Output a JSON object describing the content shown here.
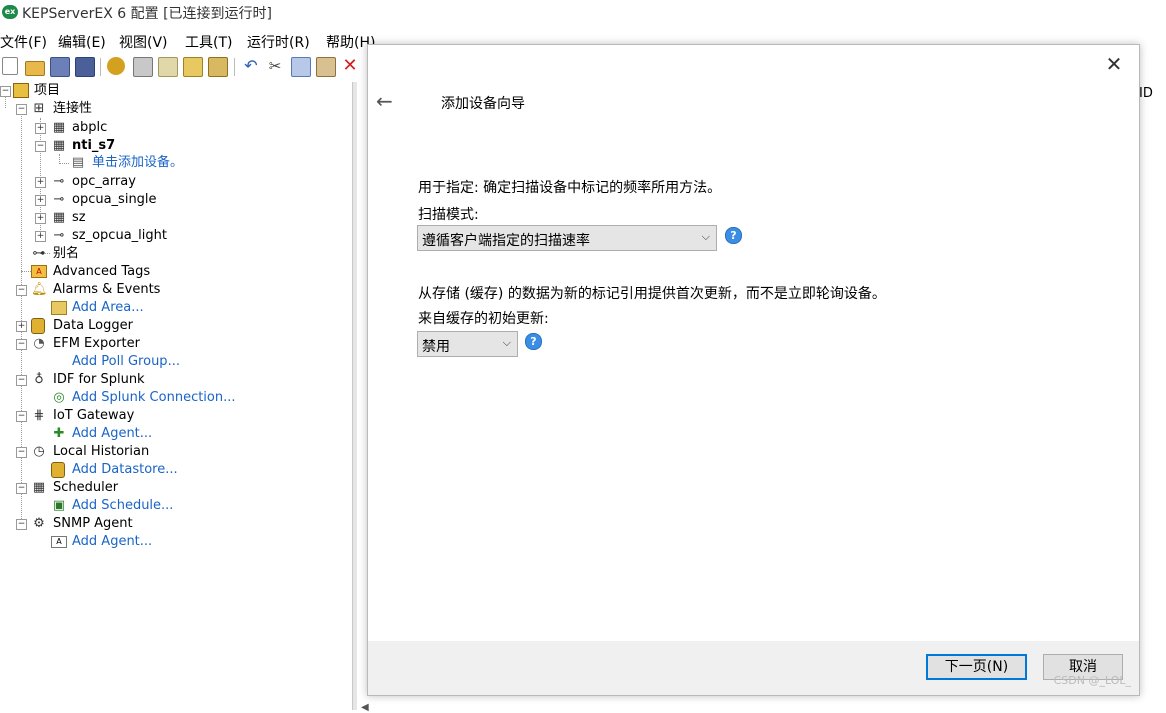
{
  "window": {
    "logo": "ex",
    "title": "KEPServerEX 6 配置 [已连接到运行时]"
  },
  "menu": [
    "文件(F)",
    "编辑(E)",
    "视图(V)",
    "工具(T)",
    "运行时(R)",
    "帮助(H)"
  ],
  "toolbar": {
    "icons": [
      "new-file-icon",
      "open-folder-icon",
      "save-icon",
      "save-as-icon",
      "runtime-gear-icon",
      "new-channel-icon",
      "new-device-icon",
      "new-tag-group-icon",
      "import-icon",
      "undo-icon",
      "cut-icon",
      "copy-icon",
      "paste-icon",
      "delete-icon"
    ]
  },
  "tree": {
    "project": "项目",
    "connectivity": "连接性",
    "abplc": "abplc",
    "nti_s7": "nti_s7",
    "add_device": "单击添加设备。",
    "opc_array": "opc_array",
    "opcua_single": "opcua_single",
    "sz": "sz",
    "sz_opcua_light": "sz_opcua_light",
    "alias": "别名",
    "advanced_tags": "Advanced Tags",
    "alarms_events": "Alarms & Events",
    "add_area": "Add Area...",
    "data_logger": "Data Logger",
    "efm_exporter": "EFM Exporter",
    "add_poll_group": "Add Poll Group...",
    "idf_splunk": "IDF for Splunk",
    "add_splunk": "Add Splunk Connection...",
    "iot_gateway": "IoT Gateway",
    "add_agent_iot": "Add Agent...",
    "local_historian": "Local Historian",
    "add_datastore": "Add Datastore...",
    "scheduler": "Scheduler",
    "add_schedule": "Add Schedule...",
    "snmp_agent": "SNMP Agent",
    "add_agent_snmp": "Add Agent..."
  },
  "rightpane": {
    "col_fragment": "ID"
  },
  "dialog": {
    "title": "添加设备向导",
    "desc1": "用于指定: 确定扫描设备中标记的频率所用方法。",
    "scan_mode_label": "扫描模式:",
    "scan_mode_value": "遵循客户端指定的扫描速率",
    "desc2": "从存储 (缓存) 的数据为新的标记引用提供首次更新，而不是立即轮询设备。",
    "cache_label": "来自缓存的初始更新:",
    "cache_value": "禁用",
    "help_glyph": "?",
    "close_glyph": "✕",
    "back_glyph": "←",
    "next_button": "下一页(N)",
    "cancel_button": "取消"
  },
  "watermark": "CSDN @_LOL_"
}
